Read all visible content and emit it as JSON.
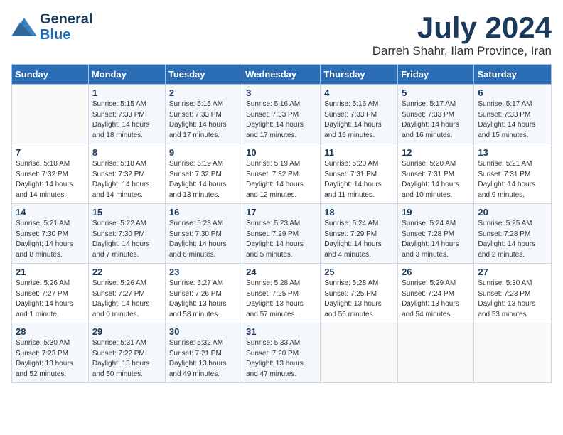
{
  "logo": {
    "line1": "General",
    "line2": "Blue"
  },
  "title": "July 2024",
  "location": "Darreh Shahr, Ilam Province, Iran",
  "days_header": [
    "Sunday",
    "Monday",
    "Tuesday",
    "Wednesday",
    "Thursday",
    "Friday",
    "Saturday"
  ],
  "weeks": [
    [
      {
        "day": "",
        "content": ""
      },
      {
        "day": "1",
        "content": "Sunrise: 5:15 AM\nSunset: 7:33 PM\nDaylight: 14 hours\nand 18 minutes."
      },
      {
        "day": "2",
        "content": "Sunrise: 5:15 AM\nSunset: 7:33 PM\nDaylight: 14 hours\nand 17 minutes."
      },
      {
        "day": "3",
        "content": "Sunrise: 5:16 AM\nSunset: 7:33 PM\nDaylight: 14 hours\nand 17 minutes."
      },
      {
        "day": "4",
        "content": "Sunrise: 5:16 AM\nSunset: 7:33 PM\nDaylight: 14 hours\nand 16 minutes."
      },
      {
        "day": "5",
        "content": "Sunrise: 5:17 AM\nSunset: 7:33 PM\nDaylight: 14 hours\nand 16 minutes."
      },
      {
        "day": "6",
        "content": "Sunrise: 5:17 AM\nSunset: 7:33 PM\nDaylight: 14 hours\nand 15 minutes."
      }
    ],
    [
      {
        "day": "7",
        "content": "Sunrise: 5:18 AM\nSunset: 7:32 PM\nDaylight: 14 hours\nand 14 minutes."
      },
      {
        "day": "8",
        "content": "Sunrise: 5:18 AM\nSunset: 7:32 PM\nDaylight: 14 hours\nand 14 minutes."
      },
      {
        "day": "9",
        "content": "Sunrise: 5:19 AM\nSunset: 7:32 PM\nDaylight: 14 hours\nand 13 minutes."
      },
      {
        "day": "10",
        "content": "Sunrise: 5:19 AM\nSunset: 7:32 PM\nDaylight: 14 hours\nand 12 minutes."
      },
      {
        "day": "11",
        "content": "Sunrise: 5:20 AM\nSunset: 7:31 PM\nDaylight: 14 hours\nand 11 minutes."
      },
      {
        "day": "12",
        "content": "Sunrise: 5:20 AM\nSunset: 7:31 PM\nDaylight: 14 hours\nand 10 minutes."
      },
      {
        "day": "13",
        "content": "Sunrise: 5:21 AM\nSunset: 7:31 PM\nDaylight: 14 hours\nand 9 minutes."
      }
    ],
    [
      {
        "day": "14",
        "content": "Sunrise: 5:21 AM\nSunset: 7:30 PM\nDaylight: 14 hours\nand 8 minutes."
      },
      {
        "day": "15",
        "content": "Sunrise: 5:22 AM\nSunset: 7:30 PM\nDaylight: 14 hours\nand 7 minutes."
      },
      {
        "day": "16",
        "content": "Sunrise: 5:23 AM\nSunset: 7:30 PM\nDaylight: 14 hours\nand 6 minutes."
      },
      {
        "day": "17",
        "content": "Sunrise: 5:23 AM\nSunset: 7:29 PM\nDaylight: 14 hours\nand 5 minutes."
      },
      {
        "day": "18",
        "content": "Sunrise: 5:24 AM\nSunset: 7:29 PM\nDaylight: 14 hours\nand 4 minutes."
      },
      {
        "day": "19",
        "content": "Sunrise: 5:24 AM\nSunset: 7:28 PM\nDaylight: 14 hours\nand 3 minutes."
      },
      {
        "day": "20",
        "content": "Sunrise: 5:25 AM\nSunset: 7:28 PM\nDaylight: 14 hours\nand 2 minutes."
      }
    ],
    [
      {
        "day": "21",
        "content": "Sunrise: 5:26 AM\nSunset: 7:27 PM\nDaylight: 14 hours\nand 1 minute."
      },
      {
        "day": "22",
        "content": "Sunrise: 5:26 AM\nSunset: 7:27 PM\nDaylight: 14 hours\nand 0 minutes."
      },
      {
        "day": "23",
        "content": "Sunrise: 5:27 AM\nSunset: 7:26 PM\nDaylight: 13 hours\nand 58 minutes."
      },
      {
        "day": "24",
        "content": "Sunrise: 5:28 AM\nSunset: 7:25 PM\nDaylight: 13 hours\nand 57 minutes."
      },
      {
        "day": "25",
        "content": "Sunrise: 5:28 AM\nSunset: 7:25 PM\nDaylight: 13 hours\nand 56 minutes."
      },
      {
        "day": "26",
        "content": "Sunrise: 5:29 AM\nSunset: 7:24 PM\nDaylight: 13 hours\nand 54 minutes."
      },
      {
        "day": "27",
        "content": "Sunrise: 5:30 AM\nSunset: 7:23 PM\nDaylight: 13 hours\nand 53 minutes."
      }
    ],
    [
      {
        "day": "28",
        "content": "Sunrise: 5:30 AM\nSunset: 7:23 PM\nDaylight: 13 hours\nand 52 minutes."
      },
      {
        "day": "29",
        "content": "Sunrise: 5:31 AM\nSunset: 7:22 PM\nDaylight: 13 hours\nand 50 minutes."
      },
      {
        "day": "30",
        "content": "Sunrise: 5:32 AM\nSunset: 7:21 PM\nDaylight: 13 hours\nand 49 minutes."
      },
      {
        "day": "31",
        "content": "Sunrise: 5:33 AM\nSunset: 7:20 PM\nDaylight: 13 hours\nand 47 minutes."
      },
      {
        "day": "",
        "content": ""
      },
      {
        "day": "",
        "content": ""
      },
      {
        "day": "",
        "content": ""
      }
    ]
  ]
}
